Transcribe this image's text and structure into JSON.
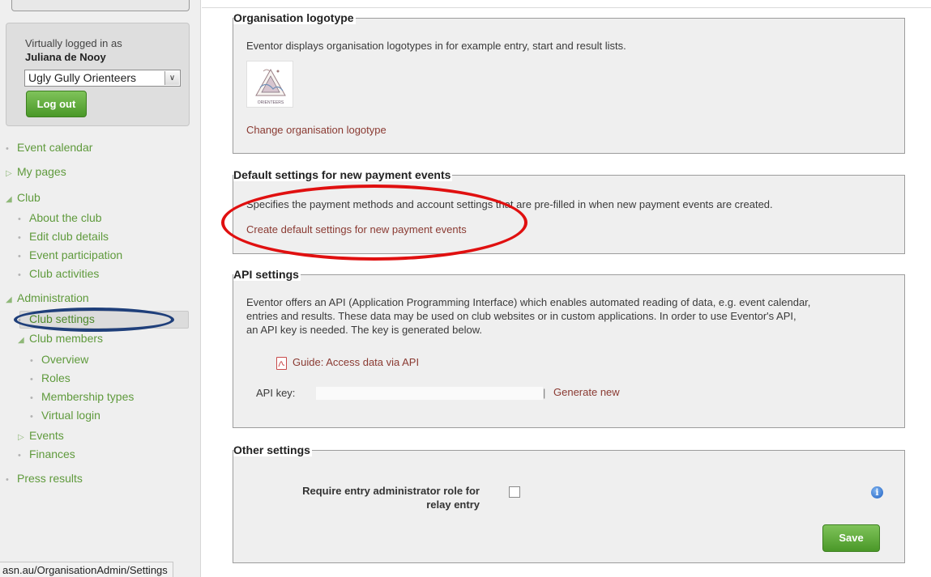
{
  "sidebar": {
    "virtually_logged_label": "Virtually logged in as",
    "user_name": "Juliana de Nooy",
    "club_select_value": "Ugly Gully Orienteers",
    "logout_label": "Log out",
    "nav": {
      "event_calendar": "Event calendar",
      "my_pages": "My pages",
      "club": "Club",
      "about_club": "About the club",
      "edit_club_details": "Edit club details",
      "event_participation": "Event participation",
      "club_activities": "Club activities",
      "administration": "Administration",
      "club_settings": "Club settings",
      "club_members": "Club members",
      "overview": "Overview",
      "roles": "Roles",
      "membership_types": "Membership types",
      "virtual_login": "Virtual login",
      "events": "Events",
      "finances": "Finances",
      "press_results": "Press results"
    }
  },
  "status_bar_url": "asn.au/OrganisationAdmin/Settings",
  "logotype": {
    "title": "Organisation logotype",
    "description": "Eventor displays organisation logotypes in for example entry, start and result lists.",
    "change_link": "Change organisation logotype",
    "logo_text": "ORIENTEERS"
  },
  "payment": {
    "title": "Default settings for new payment events",
    "description": "Specifies the payment methods and account settings that are pre-filled in when new payment events are created.",
    "create_link": "Create default settings for new payment events"
  },
  "api": {
    "title": "API settings",
    "description_lines": [
      "Eventor offers an API (Application Programming Interface) which enables automated reading of data, e.g. event calendar,",
      "entries and results. These data may be used on club websites or in custom applications. In order to use Eventor's API,",
      "an API key is needed. The key is generated below."
    ],
    "guide_link": "Guide: Access data via API",
    "api_key_label": "API key:",
    "separator": "|",
    "generate_link": "Generate new"
  },
  "other": {
    "title": "Other settings",
    "require_label_line1": "Require entry administrator role for",
    "require_label_line2": "relay entry",
    "save_label": "Save"
  },
  "colors": {
    "nav_green": "#5f9a3c",
    "link_brown": "#8a3a32",
    "button_green": "#4a9828",
    "annotation_red": "#e01010",
    "annotation_blue": "#1f3f7a"
  }
}
